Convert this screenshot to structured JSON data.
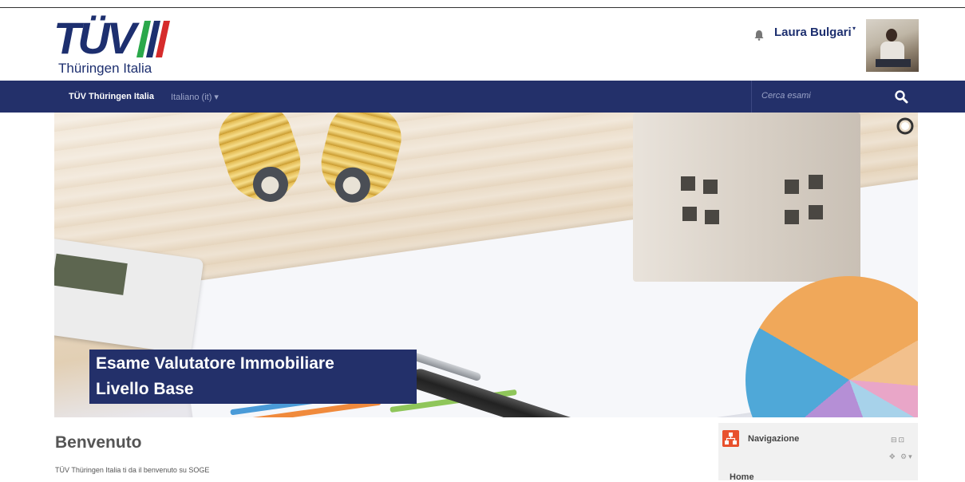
{
  "header": {
    "logo_text": "TÜV",
    "logo_subtitle": "Thüringen Italia",
    "user_name": "Laura Bulgari",
    "user_caret": "▾",
    "bell_icon": "bell-icon"
  },
  "navbar": {
    "brand": "TÜV Thüringen Italia",
    "language": "Italiano (it) ▾",
    "search_placeholder": "Cerca esami",
    "search_icon": "search-icon"
  },
  "hero": {
    "title_line1": "Esame Valutatore Immobiliare",
    "title_line2": "Livello Base"
  },
  "content": {
    "heading": "Benvenuto",
    "text": "TÜV Thüringen Italia ti da il benvenuto su SOGE"
  },
  "navigation_block": {
    "title": "Navigazione",
    "controls": "⊟⊡",
    "controls2": "✥ ⚙▾",
    "first_item": "Home"
  },
  "colors": {
    "brand_navy": "#23306a",
    "accent_orange": "#e8512d"
  }
}
